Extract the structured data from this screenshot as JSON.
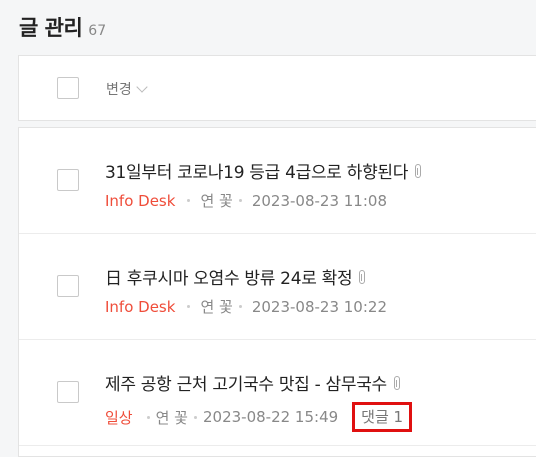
{
  "header": {
    "title": "글 관리",
    "count": "67"
  },
  "toolbar": {
    "change_label": "변경"
  },
  "posts": [
    {
      "title": "31일부터 코로나19 등급 4급으로 하향된다",
      "category": "Info Desk",
      "author": "연 꽃",
      "datetime": "2023-08-23 11:08"
    },
    {
      "title": "日 후쿠시마 오염수 방류 24로 확정",
      "category": "Info Desk",
      "author": "연 꽃",
      "datetime": "2023-08-23 10:22"
    },
    {
      "title": "제주 공항 근처 고기국수 맛집 - 삼무국수",
      "category": "일상",
      "author": "연 꽃",
      "datetime": "2023-08-22 15:49",
      "comments": "댓글 1"
    }
  ],
  "colors": {
    "accent": "#ef4d3a",
    "highlight": "#e01010"
  }
}
